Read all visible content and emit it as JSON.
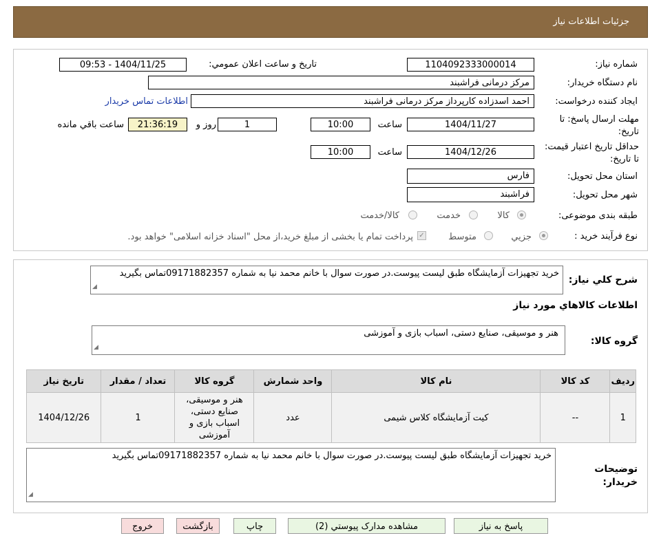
{
  "header": {
    "title": "جزئیات اطلاعات نیاز"
  },
  "fields": {
    "need_number_label": "شماره نیاز:",
    "need_number": "1104092333000014",
    "announce_label": "تاریخ و ساعت اعلان عمومي:",
    "announce_value": "1404/11/25 - 09:53",
    "buyer_label": "نام دستگاه خريدار:",
    "buyer_value": "مرکز درمانی فراشبند",
    "creator_label": "ايجاد کننده درخواست:",
    "creator_value": "احمد اسدزاده کارپرداز مرکز درمانی فراشبند",
    "contact_link": "اطلاعات تماس خريدار",
    "deadline_label": "مهلت ارسال پاسخ: تا تاریخ:",
    "deadline_date": "1404/11/27",
    "time_label": "ساعت",
    "deadline_time": "10:00",
    "days_value": "1",
    "days_label": "روز و",
    "remaining_time": "21:36:19",
    "remaining_label": "ساعت باقي مانده",
    "validity_label": "حداقل تاريخ اعتبار قیمت: تا تاریخ:",
    "validity_date": "1404/12/26",
    "validity_time": "10:00",
    "province_label": "استان محل تحویل:",
    "province_value": "فارس",
    "city_label": "شهر محل تحویل:",
    "city_value": "فراشبند",
    "category_label": "طبقه بندی موضوعی:",
    "category_options": [
      "کالا",
      "خدمت",
      "کالا/خدمت"
    ],
    "process_label": "نوع فرآیند خرید :",
    "process_options": [
      "جزيي",
      "متوسط"
    ],
    "payment_note": "پرداخت تمام یا بخشی از مبلغ خرید،از محل \"اسناد خزانه اسلامی\" خواهد بود."
  },
  "summary": {
    "label": "شرح کلي نياز:",
    "text": "خرید تجهیزات آزمایشگاه طبق لیست پیوست.در صورت سوال با خانم محمد نیا به شماره 09171882357تماس بگیرید"
  },
  "goods": {
    "section_title": "اطلاعات کالاهاي مورد نياز",
    "group_label": "گروه کالا:",
    "group_value": "هنر و موسیقی، صنایع دستی، اسباب بازی و آموزشی"
  },
  "table": {
    "headers": [
      "رديف",
      "کد کالا",
      "نام کالا",
      "واحد شمارش",
      "گروه کالا",
      "تعداد / مقدار",
      "تاريخ نياز"
    ],
    "rows": [
      [
        "1",
        "--",
        "کیت آزمایشگاه کلاس شیمی",
        "عدد",
        "هنر و موسیقی، صنایع دستی، اسباب بازی و آموزشی",
        "1",
        "1404/12/26"
      ]
    ]
  },
  "buyer_notes": {
    "label": "توضيحات خريدار:",
    "text": "خرید تجهیزات آزمایشگاه طبق لیست پیوست.در صورت سوال با خانم محمد نیا به شماره 09171882357تماس بگیرید"
  },
  "buttons": {
    "reply": "پاسخ به نیاز",
    "attachments": "مشاهده مدارک پيوستي (2)",
    "print": "چاپ",
    "back": "بازگشت",
    "exit": "خروج"
  },
  "watermark": {
    "text": "AriaTender.neT"
  }
}
